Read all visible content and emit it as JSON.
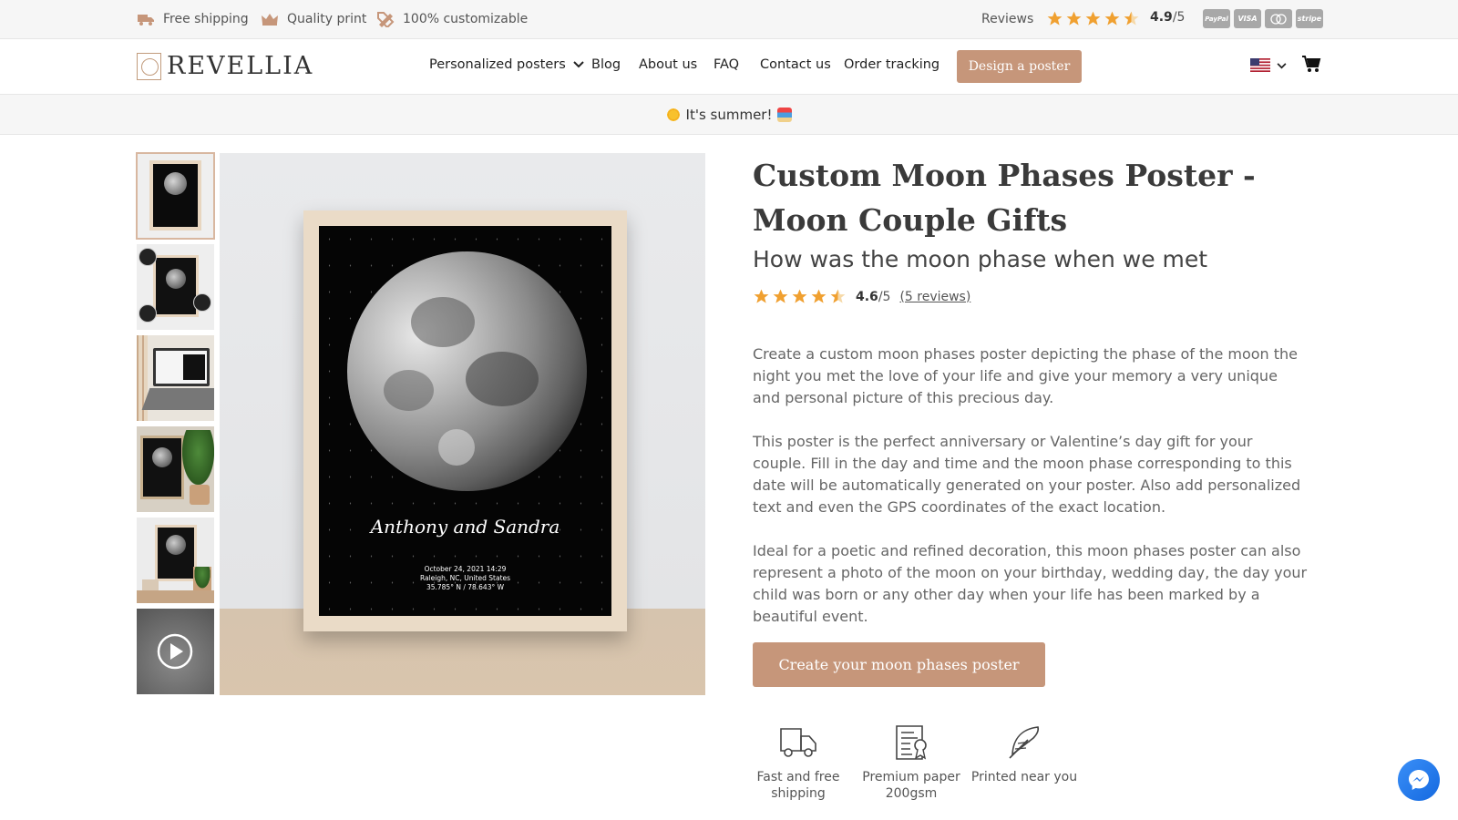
{
  "topbar": {
    "perks": [
      {
        "icon": "truck-icon",
        "label": "Free shipping"
      },
      {
        "icon": "crown-icon",
        "label": "Quality print"
      },
      {
        "icon": "pencil-ruler-icon",
        "label": "100% customizable"
      }
    ],
    "reviews_label": "Reviews",
    "rating_value": "4.9",
    "rating_max": "/5",
    "rating_stars": 4.5,
    "payment_methods": [
      "PayPal",
      "VISA",
      "Mastercard",
      "stripe"
    ]
  },
  "header": {
    "logo_text": "REVELLIA",
    "nav": [
      {
        "label": "Personalized posters",
        "has_dropdown": true
      },
      {
        "label": "Blog"
      },
      {
        "label": "About us"
      },
      {
        "label": "FAQ"
      },
      {
        "label": "Contact us"
      },
      {
        "label": "Order tracking"
      }
    ],
    "design_button": "Design a poster",
    "locale_icon": "us-flag-icon",
    "cart_icon": "cart-icon"
  },
  "promo": {
    "text": "It's summer!"
  },
  "gallery": {
    "thumbnails": [
      "poster-front",
      "poster-features",
      "laptop-editor",
      "poster-with-plant",
      "poster-on-shelf",
      "video"
    ],
    "poster": {
      "names": "Anthony and Sandra",
      "date": "October 24, 2021 14:29",
      "location": "Raleigh, NC, United States",
      "coords": "35.785° N / 78.643° W"
    }
  },
  "product": {
    "title": "Custom Moon Phases Poster - Moon Couple Gifts",
    "subtitle": "How was the moon phase when we met",
    "rating_value": "4.6",
    "rating_max": "/5",
    "rating_stars": 4.5,
    "reviews_link": "(5 reviews)",
    "description": [
      "Create a custom moon phases poster depicting the phase of the moon the night you met the love of your life and give your memory a very unique and personal picture of this precious day.",
      "This poster is the perfect anniversary or Valentine’s day gift for your couple. Fill in the day and time and the moon phase corresponding to this date will be automatically generated on your poster. Also add personalized text and even the GPS coordinates of the exact location.",
      "Ideal for a poetic and refined decoration, this moon phases poster can also represent a photo of the moon on your birthday, wedding day, the day your child was born or any other day when your life has been marked by a beautiful event."
    ],
    "cta": "Create your moon phases poster",
    "features": [
      {
        "icon": "delivery-truck-icon",
        "label": "Fast and free shipping"
      },
      {
        "icon": "paper-certificate-icon",
        "label": "Premium paper 200gsm"
      },
      {
        "icon": "feather-icon",
        "label": "Printed near you"
      }
    ]
  },
  "colors": {
    "accent": "#c6967a",
    "star": "#f0a030",
    "bar_bg": "#f6f6f6"
  },
  "chat_icon": "messenger-icon"
}
